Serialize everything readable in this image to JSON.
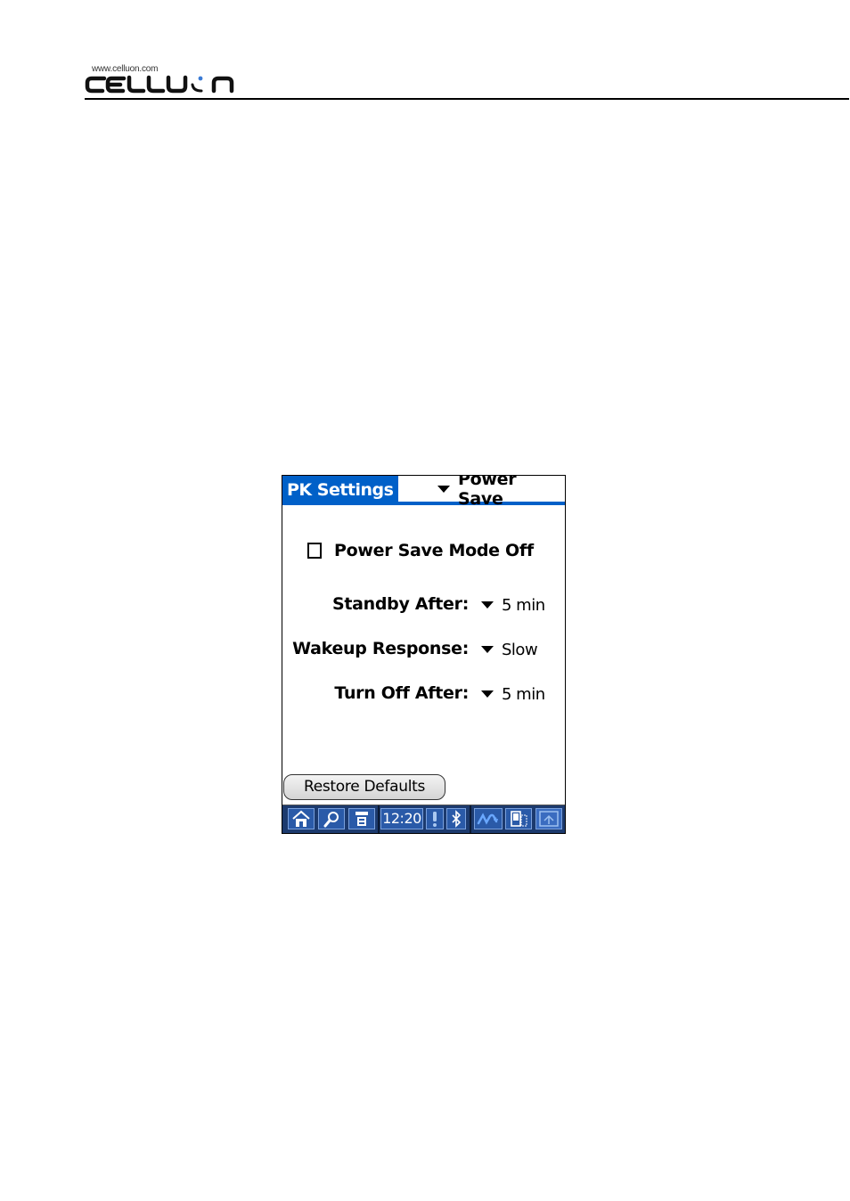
{
  "header": {
    "logo_url_text": "www.celluon.com",
    "logo_text": "CELLUON"
  },
  "app": {
    "title": "PK Settings",
    "category": "Power Save",
    "power_save_mode": {
      "label": "Power Save Mode Off",
      "checked": false
    },
    "settings": [
      {
        "label": "Standby After:",
        "value": "5 min"
      },
      {
        "label": "Wakeup Response:",
        "value": "Slow"
      },
      {
        "label": "Turn Off After:",
        "value": "5 min"
      }
    ],
    "restore_button": "Restore Defaults"
  },
  "statusbar": {
    "icons": [
      "home-icon",
      "find-icon",
      "menu-icon",
      "alert-icon",
      "bluetooth-icon",
      "graffiti-icon",
      "device-icon",
      "input-area-icon"
    ],
    "clock": "12:20"
  },
  "colors": {
    "title_blue": "#0060c8",
    "statusbar_bg": "#1c3a6e",
    "statusbar_button": "#2a5aa8"
  }
}
